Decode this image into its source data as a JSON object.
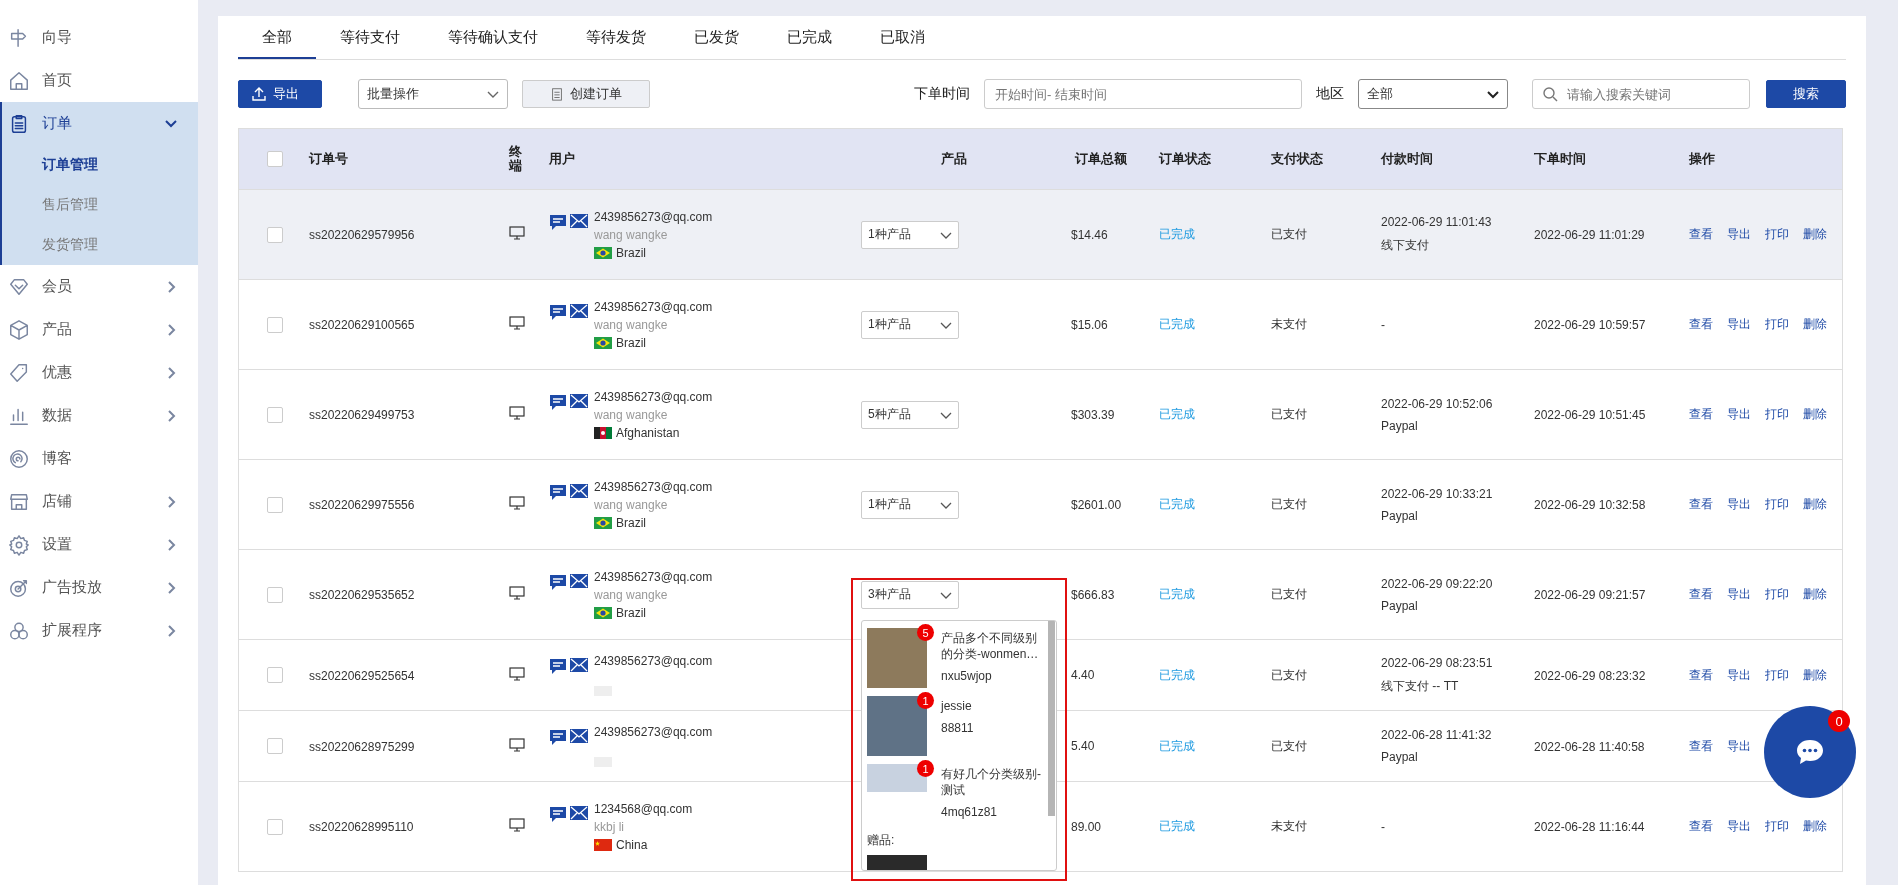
{
  "sidebar": {
    "items": [
      {
        "label": "向导",
        "expandable": false,
        "expanded": false
      },
      {
        "label": "首页",
        "expandable": false,
        "expanded": false
      },
      {
        "label": "订单",
        "expandable": true,
        "expanded": true,
        "children": [
          {
            "label": "订单管理",
            "selected": true
          },
          {
            "label": "售后管理",
            "selected": false
          },
          {
            "label": "发货管理",
            "selected": false
          }
        ]
      },
      {
        "label": "会员",
        "expandable": true,
        "expanded": false
      },
      {
        "label": "产品",
        "expandable": true,
        "expanded": false
      },
      {
        "label": "优惠",
        "expandable": true,
        "expanded": false
      },
      {
        "label": "数据",
        "expandable": true,
        "expanded": false
      },
      {
        "label": "博客",
        "expandable": false,
        "expanded": false
      },
      {
        "label": "店铺",
        "expandable": true,
        "expanded": false
      },
      {
        "label": "设置",
        "expandable": true,
        "expanded": false
      },
      {
        "label": "广告投放",
        "expandable": true,
        "expanded": false
      },
      {
        "label": "扩展程序",
        "expandable": true,
        "expanded": false
      }
    ]
  },
  "tabs": [
    {
      "label": "全部",
      "selected": true
    },
    {
      "label": "等待支付",
      "selected": false
    },
    {
      "label": "等待确认支付",
      "selected": false
    },
    {
      "label": "等待发货",
      "selected": false
    },
    {
      "label": "已发货",
      "selected": false
    },
    {
      "label": "已完成",
      "selected": false
    },
    {
      "label": "已取消",
      "selected": false
    }
  ],
  "toolbar": {
    "export_button": "导出",
    "bulk_select": "批量操作",
    "create_button": "创建订单",
    "date_label": "下单时间",
    "date_field": {
      "placeholder": "开始时间- 结束时间"
    },
    "region_label": "地区",
    "region_select": "全部",
    "search_field": {
      "placeholder": "请输入搜索关键词"
    },
    "search_button": "搜索"
  },
  "table": {
    "select_all_checked": false,
    "columns": [
      "订单号",
      "终端",
      "用户",
      "产品",
      "订单总额",
      "订单状态",
      "支付状态",
      "付款时间",
      "下单时间",
      "操作"
    ],
    "rows": [
      {
        "selected": true,
        "checked": false,
        "order_no": "ss20220629579956",
        "email": "2439856273@qq.com",
        "name": "wang wangke",
        "flag": {
          "kind": "br"
        },
        "country": "Brazil",
        "products": "1种产品",
        "amount": "$14.46",
        "order_status": "已完成",
        "pay_status": "已支付",
        "pay_time": "2022-06-29 11:01:43",
        "pay_method": "线下支付",
        "order_time": "2022-06-29 11:01:29",
        "actions": [
          "查看",
          "导出",
          "打印",
          "删除"
        ]
      },
      {
        "selected": false,
        "checked": false,
        "order_no": "ss20220629100565",
        "email": "2439856273@qq.com",
        "name": "wang wangke",
        "flag": {
          "kind": "br"
        },
        "country": "Brazil",
        "products": "1种产品",
        "amount": "$15.06",
        "order_status": "已完成",
        "pay_status": "未支付",
        "pay_time": "-",
        "order_time": "2022-06-29 10:59:57",
        "actions": [
          "查看",
          "导出",
          "打印",
          "删除"
        ]
      },
      {
        "selected": false,
        "checked": false,
        "order_no": "ss20220629499753",
        "email": "2439856273@qq.com",
        "name": "wang wangke",
        "flag": {
          "kind": "af"
        },
        "country": "Afghanistan",
        "products": "5种产品",
        "amount": "$303.39",
        "order_status": "已完成",
        "pay_status": "已支付",
        "pay_time": "2022-06-29 10:52:06",
        "pay_method": "Paypal",
        "order_time": "2022-06-29 10:51:45",
        "actions": [
          "查看",
          "导出",
          "打印",
          "删除"
        ]
      },
      {
        "selected": false,
        "checked": false,
        "order_no": "ss20220629975556",
        "email": "2439856273@qq.com",
        "name": "wang wangke",
        "flag": {
          "kind": "br"
        },
        "country": "Brazil",
        "products": "1种产品",
        "amount": "$2601.00",
        "order_status": "已完成",
        "pay_status": "已支付",
        "pay_time": "2022-06-29 10:33:21",
        "pay_method": "Paypal",
        "order_time": "2022-06-29 10:32:58",
        "actions": [
          "查看",
          "导出",
          "打印",
          "删除"
        ]
      },
      {
        "selected": false,
        "checked": false,
        "order_no": "ss20220629535652",
        "email": "2439856273@qq.com",
        "name": "wang wangke",
        "flag": {
          "kind": "br"
        },
        "country": "Brazil",
        "products": "3种产品",
        "amount": "$666.83",
        "order_status": "已完成",
        "pay_status": "已支付",
        "pay_time": "2022-06-29 09:22:20",
        "pay_method": "Paypal",
        "order_time": "2022-06-29 09:21:57",
        "actions": [
          "查看",
          "导出",
          "打印",
          "删除"
        ],
        "popup": {
          "items": [
            {
              "name": "产品多个不同级别的分类-wonmen…",
              "sku": "nxu5wjop",
              "count": "5"
            },
            {
              "name": "jessie",
              "sku": "88811",
              "count": "1"
            },
            {
              "name": "有好几个分类级别-测试",
              "sku": "4mq61z81",
              "count": "1"
            }
          ],
          "gift_label": "赠品:"
        }
      },
      {
        "selected": false,
        "checked": false,
        "order_no": "ss20220629525654",
        "email": "2439856273@qq.com",
        "flag": {
          "kind": "broken"
        },
        "amount": "4.40",
        "order_status": "已完成",
        "pay_status": "已支付",
        "pay_time": "2022-06-29 08:23:51",
        "pay_method": "线下支付 -- TT",
        "order_time": "2022-06-29 08:23:32",
        "actions": [
          "查看",
          "导出",
          "打印",
          "删除"
        ]
      },
      {
        "selected": false,
        "checked": false,
        "order_no": "ss20220628975299",
        "email": "2439856273@qq.com",
        "flag": {
          "kind": "broken"
        },
        "amount": "5.40",
        "order_status": "已完成",
        "pay_status": "已支付",
        "pay_time": "2022-06-28 11:41:32",
        "pay_method": "Paypal",
        "order_time": "2022-06-28 11:40:58",
        "actions": [
          "查看",
          "导出"
        ]
      },
      {
        "selected": false,
        "checked": false,
        "order_no": "ss20220628995110",
        "email": "1234568@qq.com",
        "name": "kkbj li",
        "flag": {
          "kind": "cn"
        },
        "country": "China",
        "amount": "89.00",
        "order_status": "已完成",
        "pay_status": "未支付",
        "pay_time": "-",
        "order_time": "2022-06-28 11:16:44",
        "actions": [
          "查看",
          "导出",
          "打印",
          "删除"
        ]
      }
    ]
  },
  "chat": {
    "badge": "0"
  }
}
